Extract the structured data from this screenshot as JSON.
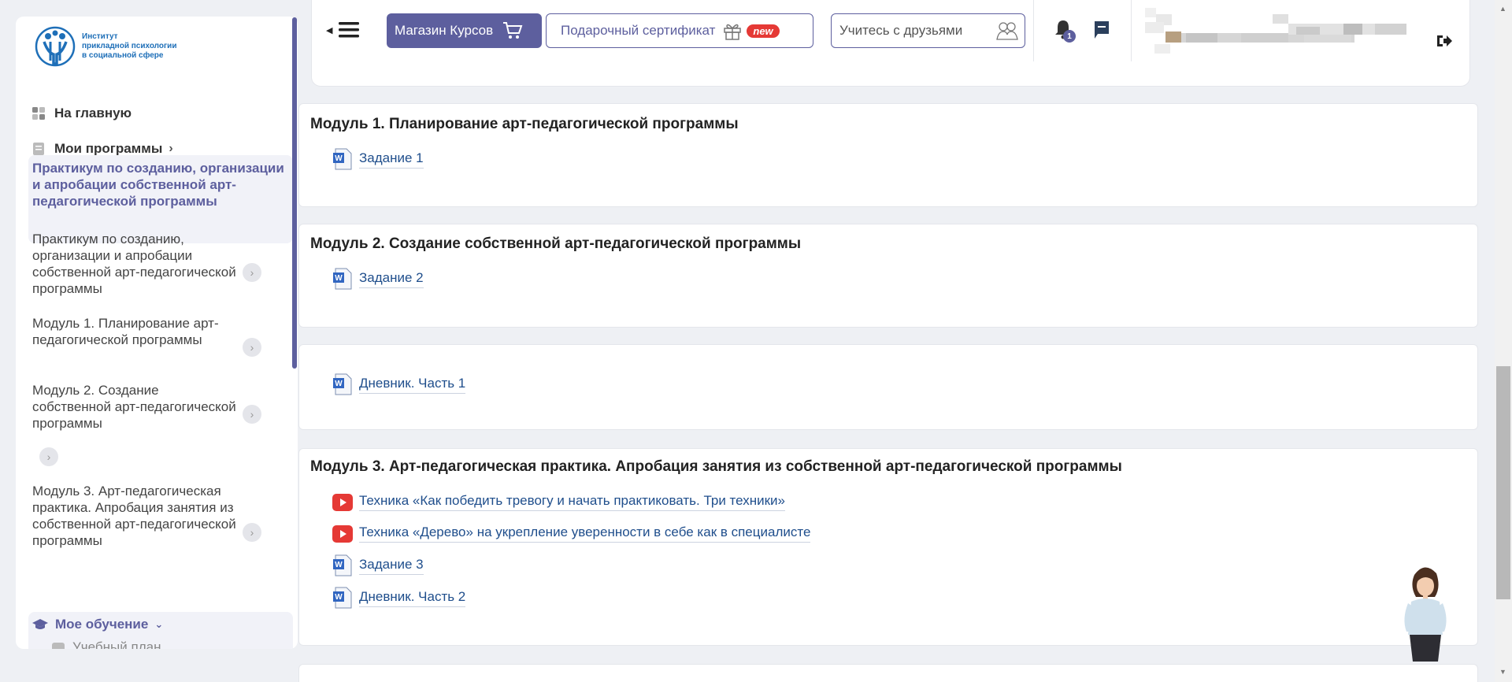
{
  "sidebar": {
    "logo_lines": [
      "Институт",
      "прикладной психологии",
      "в социальной сфере"
    ],
    "home": "На главную",
    "my_programs": "Мои программы",
    "active_program": "Практикум по созданию, организации и апробации собственной арт-педагогической программы",
    "entries": [
      "Практикум по созданию, организации и апробации собственной арт-педагогической программы",
      "Модуль 1. Планирование арт-педагогической программы",
      "Модуль 2. Создание собственной арт-педагогической программы",
      "Модуль 3. Арт-педагогическая практика. Апробация занятия из собственной арт-педагогической программы"
    ],
    "my_learning": "Мое обучение",
    "study_plan": "Учебный план"
  },
  "header": {
    "shop": "Магазин Курсов",
    "gift": "Подарочный сертификат",
    "gift_badge": "new",
    "study_placeholder": "Учитесь с друзьями",
    "notifications_count": "1"
  },
  "modules": [
    {
      "title": "Модуль 1. Планирование арт-педагогической программы",
      "items": [
        {
          "type": "doc",
          "label": "Задание 1"
        }
      ]
    },
    {
      "title": "Модуль 2. Создание собственной арт-педагогической программы",
      "items": [
        {
          "type": "doc",
          "label": "Задание 2"
        }
      ]
    },
    {
      "title": "",
      "items": [
        {
          "type": "doc",
          "label": "Дневник. Часть 1"
        }
      ]
    },
    {
      "title": "Модуль 3. Арт-педагогическая практика. Апробация занятия из собственной арт-педагогической программы",
      "items": [
        {
          "type": "video",
          "label": "Техника «Как победить тревогу и начать практиковать. Три техники»"
        },
        {
          "type": "video",
          "label": "Техника «Дерево» на укрепление уверенности в себе как в специалисте"
        },
        {
          "type": "doc",
          "label": "Задание 3"
        },
        {
          "type": "doc",
          "label": "Дневник. Часть 2"
        }
      ]
    }
  ],
  "colors": {
    "accent": "#5d5f9e",
    "link": "#1f4e8c",
    "youtube": "#e53935",
    "badge": "#e53935"
  },
  "icons": [
    "hamburger-icon",
    "cart-icon",
    "gift-icon",
    "friends-icon",
    "bell-icon",
    "chat-icon",
    "logout-icon",
    "word-doc-icon",
    "youtube-icon",
    "grid-icon",
    "book-icon",
    "graduation-cap-icon",
    "chevron-right-icon"
  ]
}
